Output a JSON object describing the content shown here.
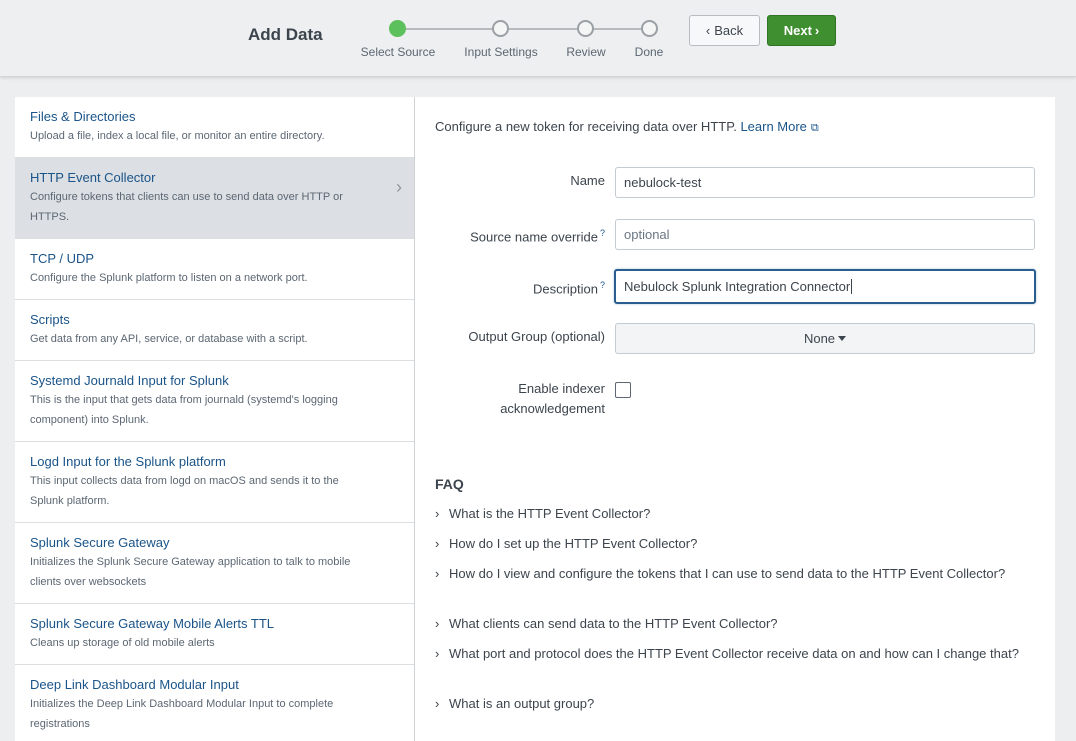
{
  "header": {
    "title": "Add Data",
    "steps": [
      "Select Source",
      "Input Settings",
      "Review",
      "Done"
    ],
    "back_label": "Back",
    "next_label": "Next",
    "accent": "#5cc05c",
    "next_color": "#3f8e2f"
  },
  "sources": [
    {
      "title": "Files & Directories",
      "desc": "Upload a file, index a local file, or monitor an entire directory."
    },
    {
      "title": "HTTP Event Collector",
      "desc": "Configure tokens that clients can use to send data over HTTP or HTTPS."
    },
    {
      "title": "TCP / UDP",
      "desc": "Configure the Splunk platform to listen on a network port."
    },
    {
      "title": "Scripts",
      "desc": "Get data from any API, service, or database with a script."
    },
    {
      "title": "Systemd Journald Input for Splunk",
      "desc": "This is the input that gets data from journald (systemd's logging component) into Splunk."
    },
    {
      "title": "Logd Input for the Splunk platform",
      "desc": "This input collects data from logd on macOS and sends it to the Splunk platform."
    },
    {
      "title": "Splunk Secure Gateway",
      "desc": "Initializes the Splunk Secure Gateway application to talk to mobile clients over websockets"
    },
    {
      "title": "Splunk Secure Gateway Mobile Alerts TTL",
      "desc": "Cleans up storage of old mobile alerts"
    },
    {
      "title": "Deep Link Dashboard Modular Input",
      "desc": "Initializes the Deep Link Dashboard Modular Input to complete registrations"
    }
  ],
  "form": {
    "intro": "Configure a new token for receiving data over HTTP.",
    "learn_more": "Learn More",
    "name_label": "Name",
    "name_value": "nebulock-test",
    "source_label": "Source name override",
    "source_placeholder": "optional",
    "desc_label": "Description",
    "desc_value": "Nebulock Splunk Integration Connector",
    "output_label": "Output Group (optional)",
    "output_value": "None",
    "ack_label_1": "Enable indexer",
    "ack_label_2": "acknowledgement",
    "help_mark": "?"
  },
  "faq": {
    "title": "FAQ",
    "items": [
      "What is the HTTP Event Collector?",
      "How do I set up the HTTP Event Collector?",
      "How do I view and configure the tokens that I can use to send data to the HTTP Event Collector?",
      "What clients can send data to the HTTP Event Collector?",
      "What port and protocol does the HTTP Event Collector receive data on and how can I change that?",
      "What is an output group?"
    ]
  }
}
